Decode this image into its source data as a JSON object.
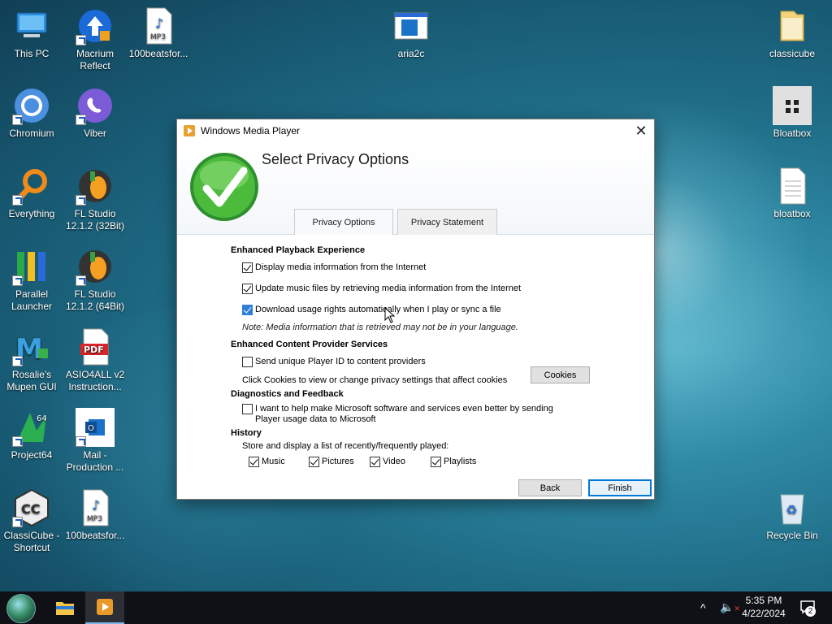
{
  "desktop": {
    "icons": [
      {
        "label": "This PC"
      },
      {
        "label": "Macrium Reflect"
      },
      {
        "label": "100beatsfor...",
        "badge": "MP3"
      },
      {
        "label": "aria2c"
      },
      {
        "label": "classicube"
      },
      {
        "label": "Chromium"
      },
      {
        "label": "Viber"
      },
      {
        "label": "Bloatbox"
      },
      {
        "label": "Everything"
      },
      {
        "label": "FL Studio 12.1.2 (32Bit)"
      },
      {
        "label": "bloatbox"
      },
      {
        "label": "Parallel Launcher"
      },
      {
        "label": "FL Studio 12.1.2 (64Bit)"
      },
      {
        "label": "Rosalie's Mupen GUI"
      },
      {
        "label": "ASIO4ALL v2 Instruction...",
        "badge": "PDF"
      },
      {
        "label": "Project64"
      },
      {
        "label": "Mail - Production ..."
      },
      {
        "label": "ClassiCube - Shortcut"
      },
      {
        "label": "100beatsfor...",
        "badge": "MP3"
      },
      {
        "label": "Recycle Bin"
      }
    ]
  },
  "dialog": {
    "title": "Windows Media Player",
    "heading": "Select Privacy Options",
    "tabs": [
      {
        "label": "Privacy Options",
        "active": true
      },
      {
        "label": "Privacy Statement",
        "active": false
      }
    ],
    "sections": {
      "playback": {
        "heading": "Enhanced Playback Experience",
        "options": [
          {
            "label": "Display media information from the Internet",
            "checked": true
          },
          {
            "label": "Update music files by retrieving media information from the Internet",
            "checked": true
          },
          {
            "label": "Download usage rights automatically when I play or sync a file",
            "checked": true
          }
        ],
        "note": "Note: Media information that is retrieved may not be in your language."
      },
      "content_provider": {
        "heading": "Enhanced Content Provider Services",
        "option": {
          "label": "Send unique Player ID to content providers",
          "checked": false
        },
        "cookies_text": "Click Cookies to view or change privacy settings that affect cookies",
        "cookies_button": "Cookies"
      },
      "diagnostics": {
        "heading": "Diagnostics and Feedback",
        "option_line1": "I want to help make Microsoft software and services even better by sending",
        "option_line2": "Player usage data to Microsoft",
        "checked": false
      },
      "history": {
        "heading": "History",
        "text": "Store and display a list of recently/frequently played:",
        "options": [
          {
            "label": "Music",
            "checked": true
          },
          {
            "label": "Pictures",
            "checked": true
          },
          {
            "label": "Video",
            "checked": true
          },
          {
            "label": "Playlists",
            "checked": true
          }
        ]
      }
    },
    "buttons": {
      "back": "Back",
      "finish": "Finish"
    }
  },
  "taskbar": {
    "time": "5:35 PM",
    "date": "4/22/2024",
    "notification_count": "2"
  },
  "colors": {
    "accent": "#0078d7",
    "check_green": "#3aa53a"
  }
}
